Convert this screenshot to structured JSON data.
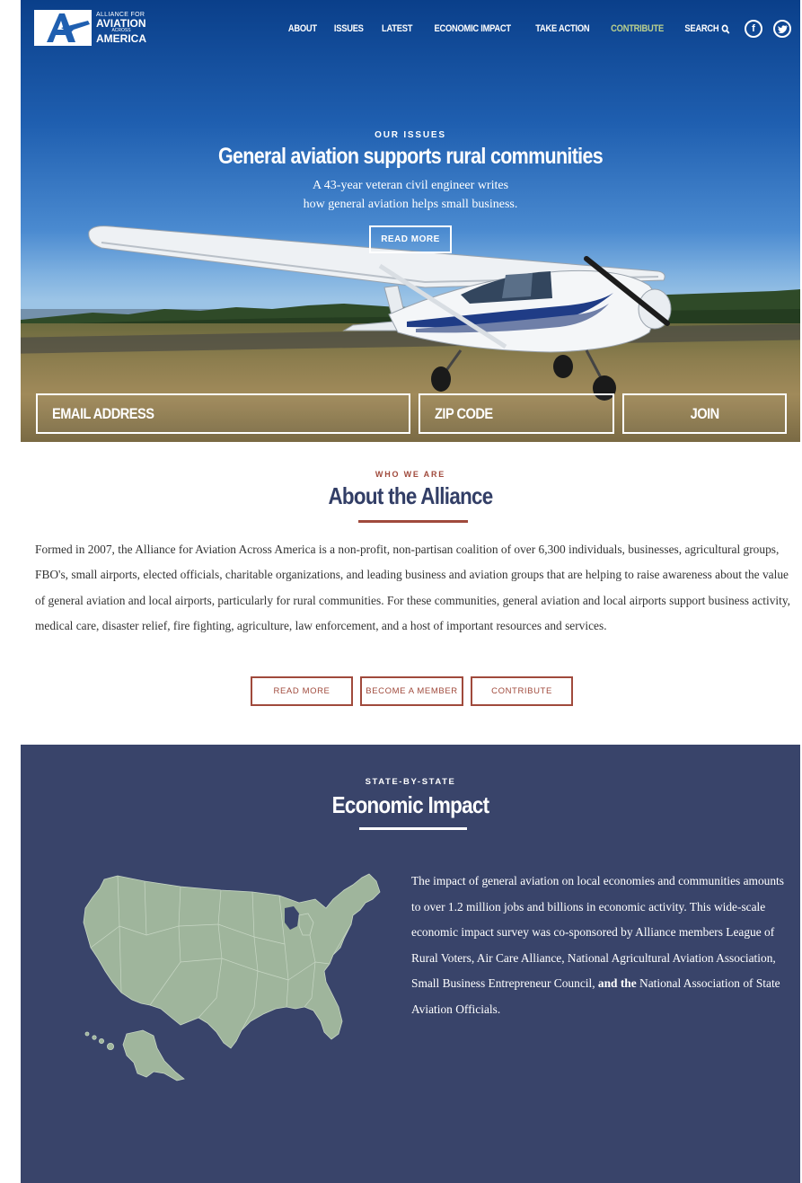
{
  "logo": {
    "line1": "ALLIANCE FOR",
    "line2": "AVIATION",
    "line3": "ACROSS",
    "line4": "AMERICA",
    "icon": "plane-logo-icon"
  },
  "nav": {
    "items": [
      "ABOUT",
      "ISSUES",
      "LATEST",
      "ECONOMIC IMPACT",
      "TAKE ACTION",
      "CONTRIBUTE"
    ],
    "search_label": "SEARCH",
    "social": [
      "facebook-icon",
      "twitter-icon"
    ]
  },
  "hero": {
    "eyebrow": "OUR ISSUES",
    "title": "General aviation supports rural communities",
    "subtitle_line1": "A 43-year veteran civil engineer writes",
    "subtitle_line2": "how general aviation helps small business.",
    "button": "READ MORE"
  },
  "signup": {
    "email_placeholder": "EMAIL ADDRESS",
    "zip_placeholder": "ZIP CODE",
    "join_label": "JOIN"
  },
  "about": {
    "eyebrow": "WHO WE ARE",
    "title": "About the Alliance",
    "body": "Formed in 2007, the Alliance for Aviation Across America is a non-profit, non-partisan coalition of over 6,300 individuals, businesses, agricultural groups, FBO's, small airports, elected officials, charitable organizations, and leading business and aviation groups that are helping to raise awareness about the value of general aviation and local airports, particularly for rural communities.  For these communities, general aviation and local airports support business activity, medical care, disaster relief, fire fighting, agriculture, law enforcement, and a host of important resources and services.",
    "buttons": [
      "READ MORE",
      "BECOME A MEMBER",
      "CONTRIBUTE"
    ]
  },
  "econ": {
    "eyebrow": "STATE-BY-STATE",
    "title": "Economic Impact",
    "body_main": "The impact of general aviation on local economies and communities amounts to over 1.2 million jobs and billions in economic activity. This wide-scale economic impact survey was co-sponsored by Alliance members League of Rural Voters, Air Care Alliance, National Agricultural Aviation Association, Small Business Entrepreneur Council, ",
    "body_bold": "and the",
    "body_end": " National Association of State Aviation Officials."
  },
  "colors": {
    "accent_red": "#a04a3c",
    "navy": "#39446a",
    "title_navy": "#323e66",
    "map_green": "#9fb59c",
    "nav_accent": "#b9d08e"
  }
}
